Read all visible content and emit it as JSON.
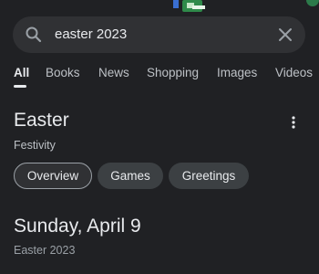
{
  "search": {
    "query": "easter 2023",
    "icon": "search-icon",
    "clear_icon": "close-icon"
  },
  "tabs": [
    {
      "label": "All",
      "active": true
    },
    {
      "label": "Books"
    },
    {
      "label": "News"
    },
    {
      "label": "Shopping"
    },
    {
      "label": "Images"
    },
    {
      "label": "Videos"
    }
  ],
  "knowledge": {
    "title": "Easter",
    "subtitle": "Festivity",
    "menu_icon": "more-vert-icon"
  },
  "chips": [
    {
      "label": "Overview",
      "selected": true
    },
    {
      "label": "Games"
    },
    {
      "label": "Greetings"
    }
  ],
  "date": {
    "title": "Sunday, April 9",
    "subtitle": "Easter 2023"
  },
  "colors": {
    "background": "#202124",
    "surface": "#303134",
    "chip": "#3c4043",
    "text": "#e8eaed",
    "muted": "#bdc1c6",
    "doodle_green": "#3aa85c"
  }
}
